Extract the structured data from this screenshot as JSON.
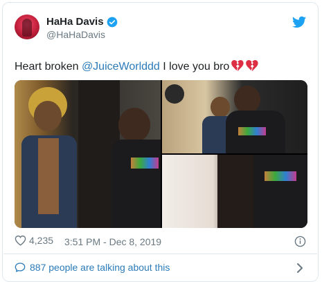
{
  "tweet": {
    "display_name": "HaHa Davis",
    "handle": "@HaHaDavis",
    "text_before": "Heart broken ",
    "mention": "@JuiceWorlddd",
    "text_after": " I love you bro",
    "emoji": [
      "broken-heart-icon",
      "broken-heart-icon"
    ],
    "like_count": "4,235",
    "timestamp": "3:51 PM - Dec 8, 2019",
    "talking": "887 people are talking about this"
  },
  "icons": {
    "verified": "verified-badge-icon",
    "twitter": "twitter-bird-icon",
    "like": "heart-outline-icon",
    "info": "info-icon",
    "talking": "speech-bubble-icon",
    "chevron": "chevron-right-icon"
  },
  "colors": {
    "link": "#2b7bb9",
    "muted": "#697882",
    "twitter_blue": "#1da1f2",
    "broken_heart": "#dd2e44"
  }
}
